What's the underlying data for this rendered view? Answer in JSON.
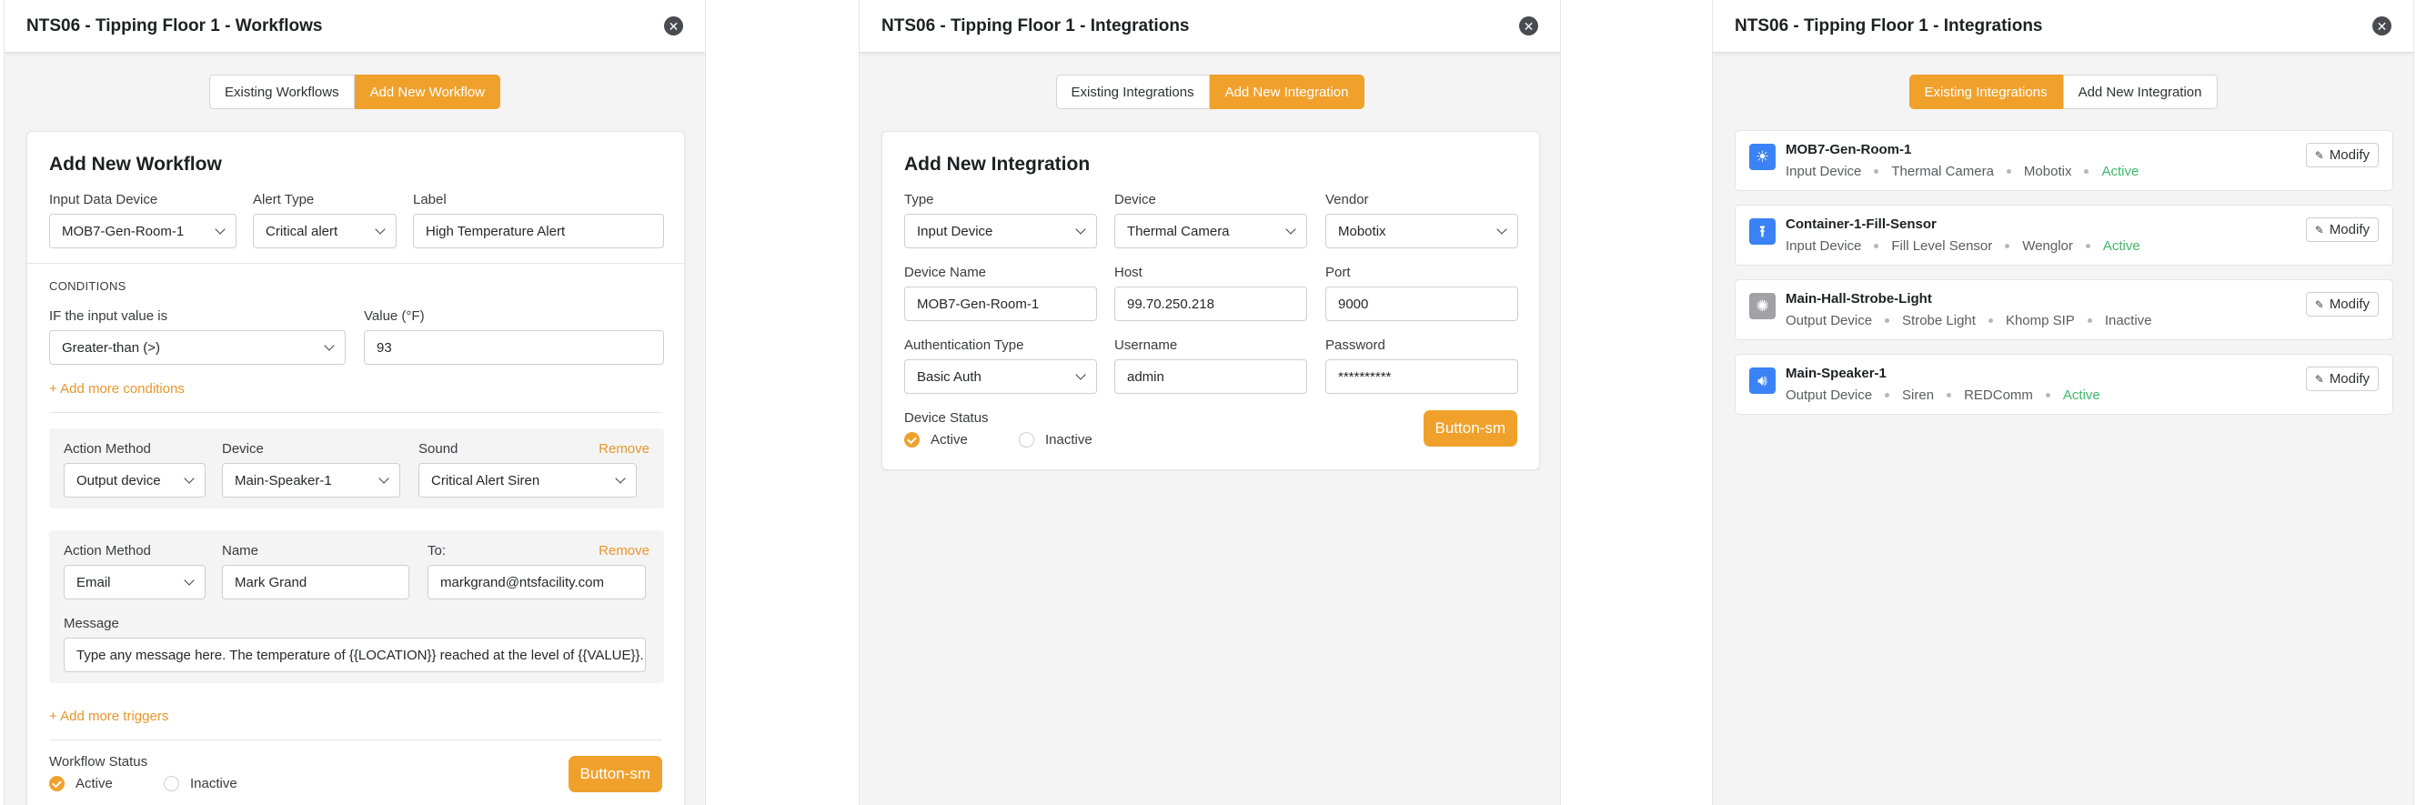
{
  "workflows": {
    "title": "NTS06 - Tipping Floor 1 - Workflows",
    "tabs": [
      "Existing Workflows",
      "Add New Workflow"
    ],
    "card_title": "Add New Workflow",
    "input_device_label": "Input Data Device",
    "input_device_value": "MOB7-Gen-Room-1",
    "alert_type_label": "Alert Type",
    "alert_type_value": "Critical alert",
    "label_label": "Label",
    "label_value": "High Temperature Alert",
    "conditions_heading": "CONDITIONS",
    "if_label": "IF the input value is",
    "if_value": "Greater-than (>)",
    "value_label": "Value (°F)",
    "value_value": "93",
    "add_conditions": "+ Add more conditions",
    "action1": {
      "method_label": "Action Method",
      "method_value": "Output device",
      "device_label": "Device",
      "device_value": "Main-Speaker-1",
      "sound_label": "Sound",
      "sound_value": "Critical Alert Siren",
      "remove": "Remove"
    },
    "action2": {
      "method_label": "Action Method",
      "method_value": "Email",
      "name_label": "Name",
      "name_value": "Mark Grand",
      "to_label": "To:",
      "to_value": "markgrand@ntsfacility.com",
      "remove": "Remove",
      "message_label": "Message",
      "message_value": "Type any message here. The temperature of {{LOCATION}} reached at the level of {{VALUE}}."
    },
    "add_triggers": "+ Add more triggers",
    "status_label": "Workflow Status",
    "status_active": "Active",
    "status_inactive": "Inactive",
    "button": "Button-sm"
  },
  "add_integration": {
    "title": "NTS06 - Tipping Floor 1 - Integrations",
    "tabs": [
      "Existing Integrations",
      "Add New Integration"
    ],
    "card_title": "Add New Integration",
    "type_label": "Type",
    "type_value": "Input Device",
    "device_label": "Device",
    "device_value": "Thermal Camera",
    "vendor_label": "Vendor",
    "vendor_value": "Mobotix",
    "device_name_label": "Device Name",
    "device_name_value": "MOB7-Gen-Room-1",
    "host_label": "Host",
    "host_value": "99.70.250.218",
    "port_label": "Port",
    "port_value": "9000",
    "auth_label": "Authentication Type",
    "auth_value": "Basic Auth",
    "username_label": "Username",
    "username_value": "admin",
    "password_label": "Password",
    "password_value": "**********",
    "status_label": "Device Status",
    "status_active": "Active",
    "status_inactive": "Inactive",
    "button": "Button-sm"
  },
  "existing_integrations": {
    "title": "NTS06 - Tipping Floor 1 - Integrations",
    "tabs": [
      "Existing Integrations",
      "Add New Integration"
    ],
    "modify_label": "Modify",
    "items": [
      {
        "name": "MOB7-Gen-Room-1",
        "kind": "Input Device",
        "device": "Thermal Camera",
        "vendor": "Mobotix",
        "status": "Active",
        "icon": "sun-icon",
        "icon_color": "#3b82f6"
      },
      {
        "name": "Container-1-Fill-Sensor",
        "kind": "Input Device",
        "device": "Fill Level Sensor",
        "vendor": "Wenglor",
        "status": "Active",
        "icon": "upload-icon",
        "icon_color": "#3b82f6"
      },
      {
        "name": "Main-Hall-Strobe-Light",
        "kind": "Output Device",
        "device": "Strobe Light",
        "vendor": "Khomp SIP",
        "status": "Inactive",
        "icon": "lightbulb-icon",
        "icon_color": "#a1a1a6"
      },
      {
        "name": "Main-Speaker-1",
        "kind": "Output Device",
        "device": "Siren",
        "vendor": "REDComm",
        "status": "Active",
        "icon": "speaker-icon",
        "icon_color": "#3b82f6"
      }
    ]
  },
  "colors": {
    "accent": "#f0a12c",
    "active_status": "#3fb76a",
    "icon_blue": "#3b82f6",
    "icon_gray": "#a1a1a6"
  }
}
